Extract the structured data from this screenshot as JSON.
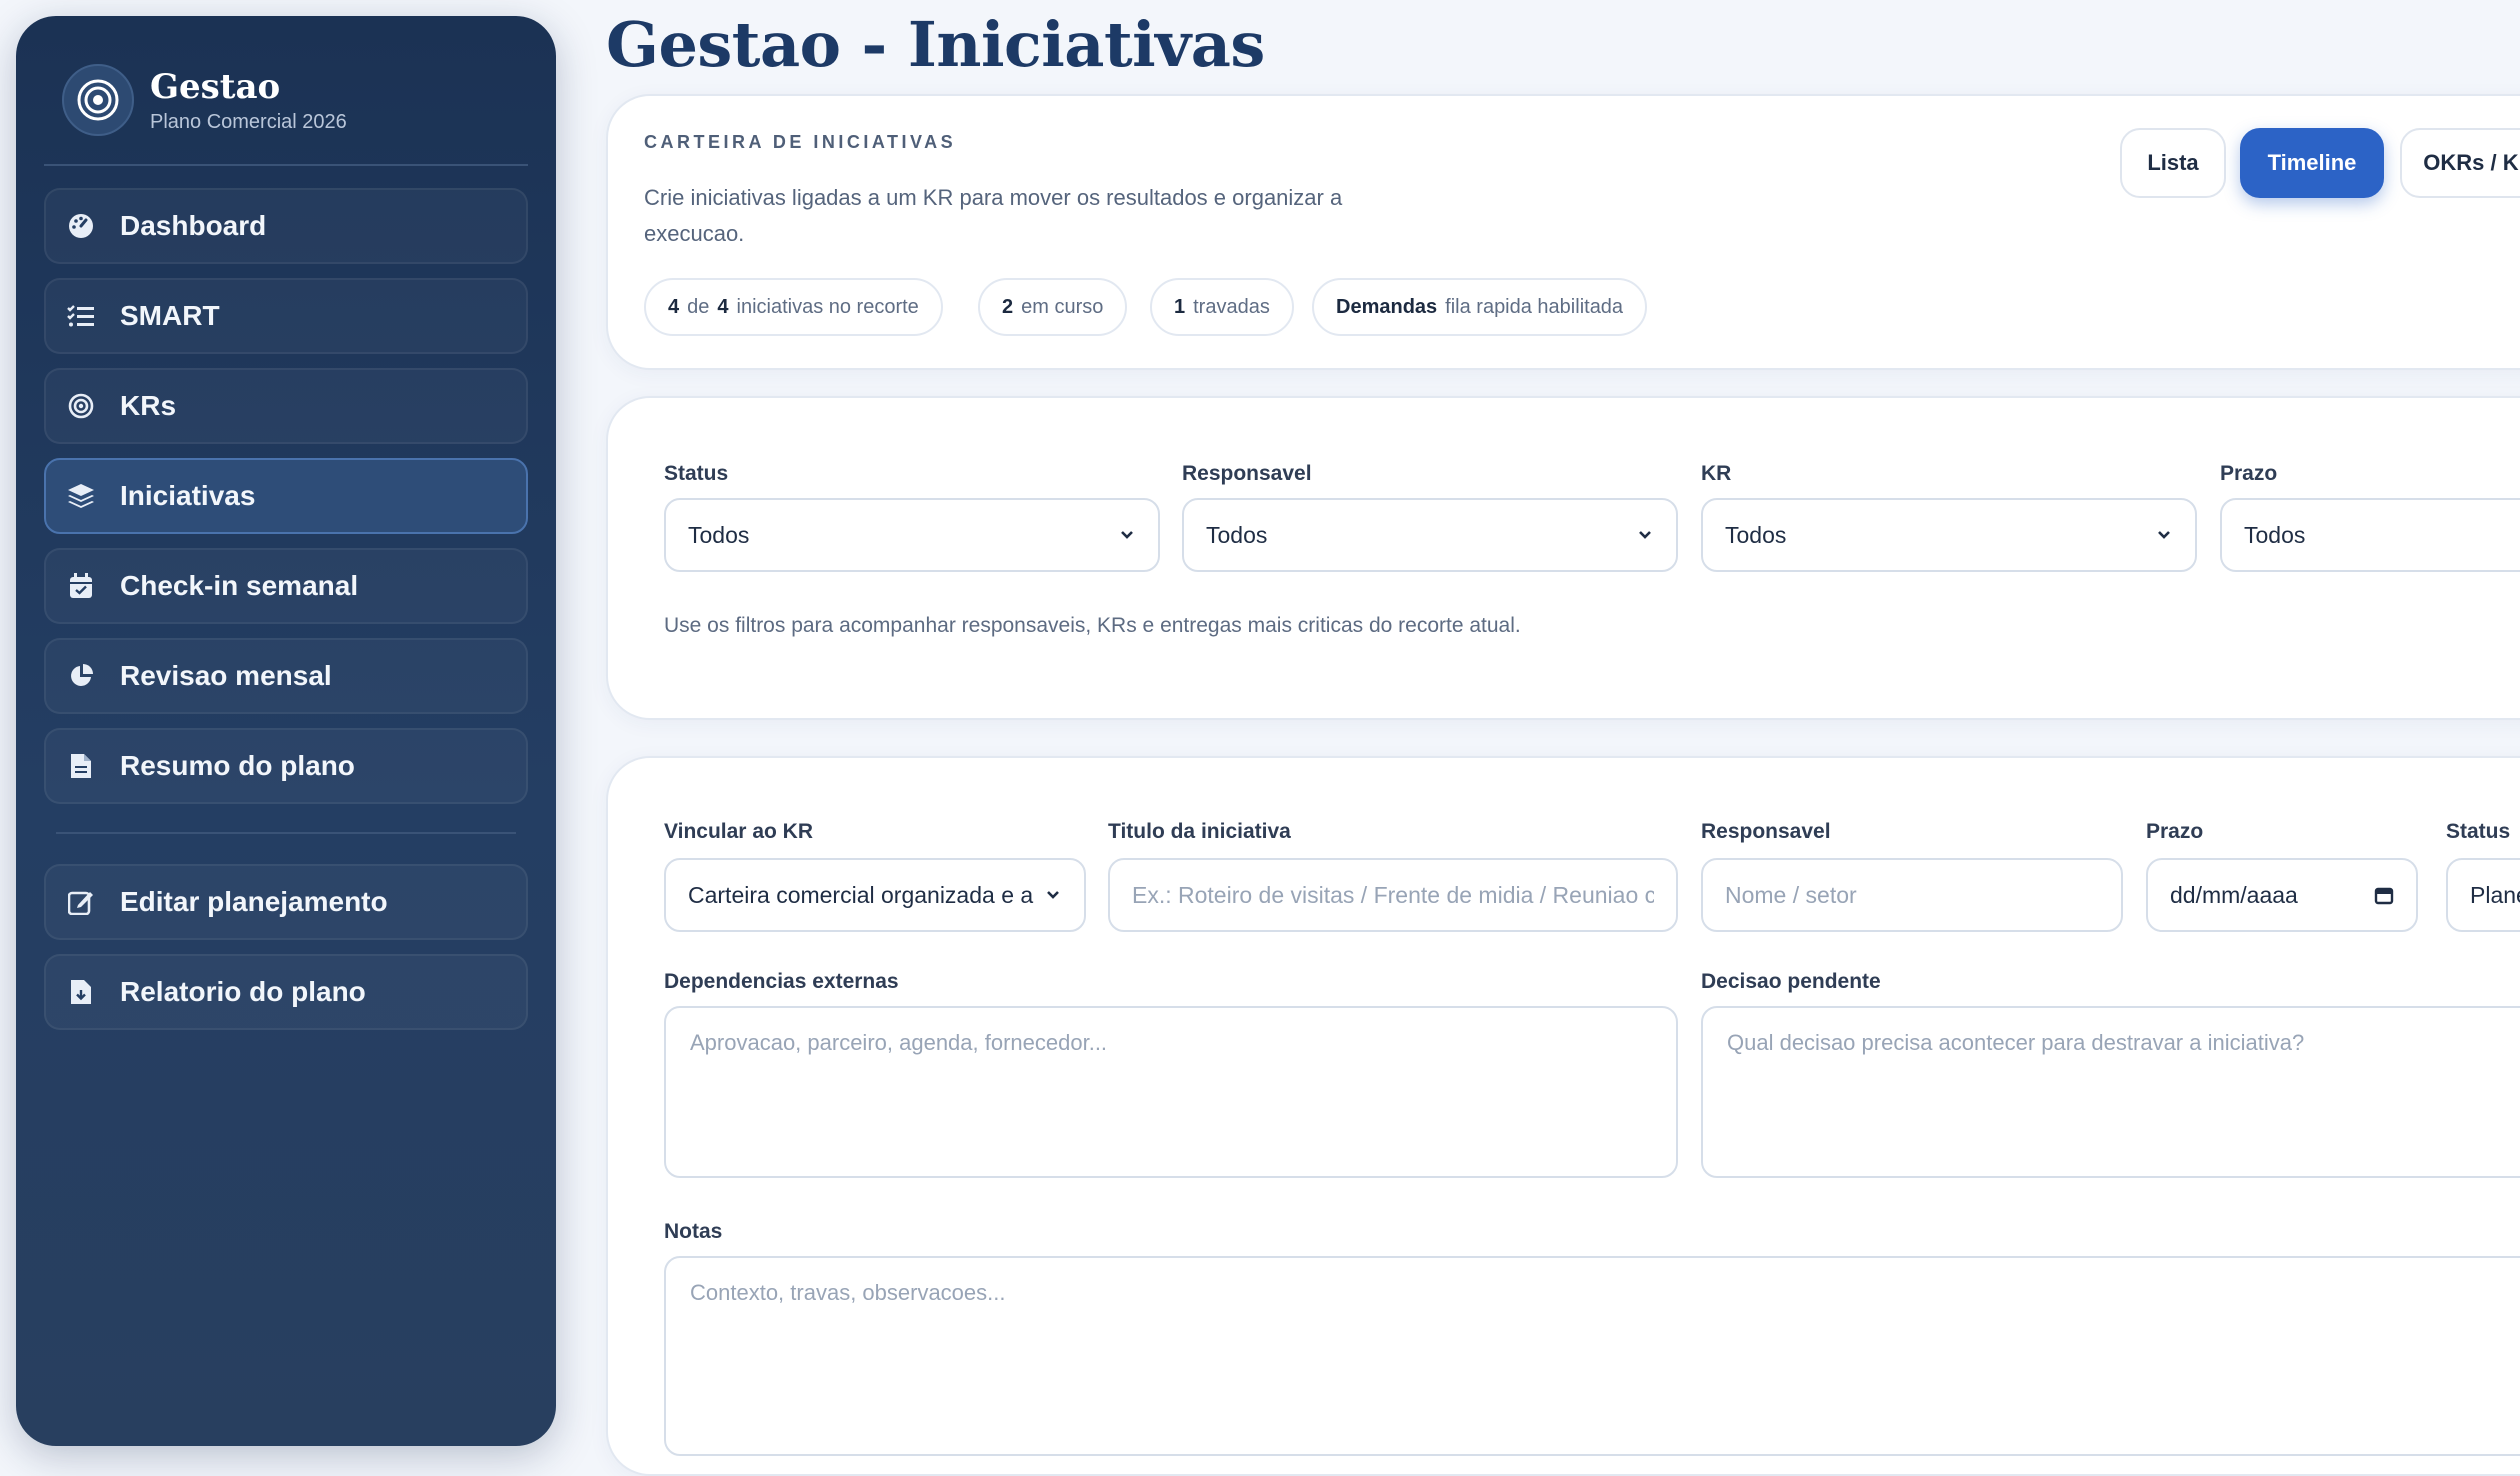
{
  "brand": {
    "title": "Gestao",
    "subtitle": "Plano Comercial 2026"
  },
  "sidebar": {
    "items": [
      {
        "label": "Dashboard",
        "icon": "gauge-icon"
      },
      {
        "label": "SMART",
        "icon": "checklist-icon"
      },
      {
        "label": "KRs",
        "icon": "target-icon"
      },
      {
        "label": "Iniciativas",
        "icon": "layers-icon",
        "active": true
      },
      {
        "label": "Check-in semanal",
        "icon": "calendar-check-icon"
      },
      {
        "label": "Revisao mensal",
        "icon": "pie-chart-icon"
      },
      {
        "label": "Resumo do plano",
        "icon": "document-icon"
      }
    ],
    "secondary": [
      {
        "label": "Editar planejamento",
        "icon": "edit-icon"
      },
      {
        "label": "Relatorio do plano",
        "icon": "file-download-icon"
      }
    ]
  },
  "page": {
    "title": "Gestao - Iniciativas"
  },
  "portfolio": {
    "eyebrow": "CARTEIRA DE INICIATIVAS",
    "description": "Crie iniciativas ligadas a um KR para mover os resultados e organizar a execucao.",
    "views": [
      "Lista",
      "Timeline",
      "OKRs / KRs"
    ],
    "active_view": "Timeline",
    "chips": {
      "count_a": "4",
      "of": "de",
      "count_b": "4",
      "count_text": "iniciativas no recorte",
      "progress_n": "2",
      "progress_text": "em curso",
      "blocked_n": "1",
      "blocked_text": "travadas",
      "demand_strong": "Demandas",
      "demand_text": "fila rapida habilitada"
    }
  },
  "filters": {
    "status": {
      "label": "Status",
      "value": "Todos"
    },
    "owner": {
      "label": "Responsavel",
      "value": "Todos"
    },
    "kr": {
      "label": "KR",
      "value": "Todos"
    },
    "deadline": {
      "label": "Prazo",
      "value": "Todos"
    },
    "hint": "Use os filtros para acompanhar responsaveis, KRs e entregas mais criticas do recorte atual."
  },
  "form": {
    "kr": {
      "label": "Vincular ao KR",
      "value": "Carteira comercial organizada e acionada"
    },
    "title": {
      "label": "Titulo da iniciativa",
      "placeholder": "Ex.: Roteiro de visitas / Frente de midia / Reuniao com parceiro"
    },
    "owner": {
      "label": "Responsavel",
      "placeholder": "Nome / setor"
    },
    "deadline": {
      "label": "Prazo",
      "placeholder": "dd/mm/aaaa"
    },
    "status": {
      "label": "Status",
      "value": "Planejada"
    },
    "dependencies": {
      "label": "Dependencias externas",
      "placeholder": "Aprovacao, parceiro, agenda, fornecedor..."
    },
    "decision": {
      "label": "Decisao pendente",
      "placeholder": "Qual decisao precisa acontecer para destravar a iniciativa?"
    },
    "notes": {
      "label": "Notas",
      "placeholder": "Contexto, travas, observacoes..."
    }
  }
}
